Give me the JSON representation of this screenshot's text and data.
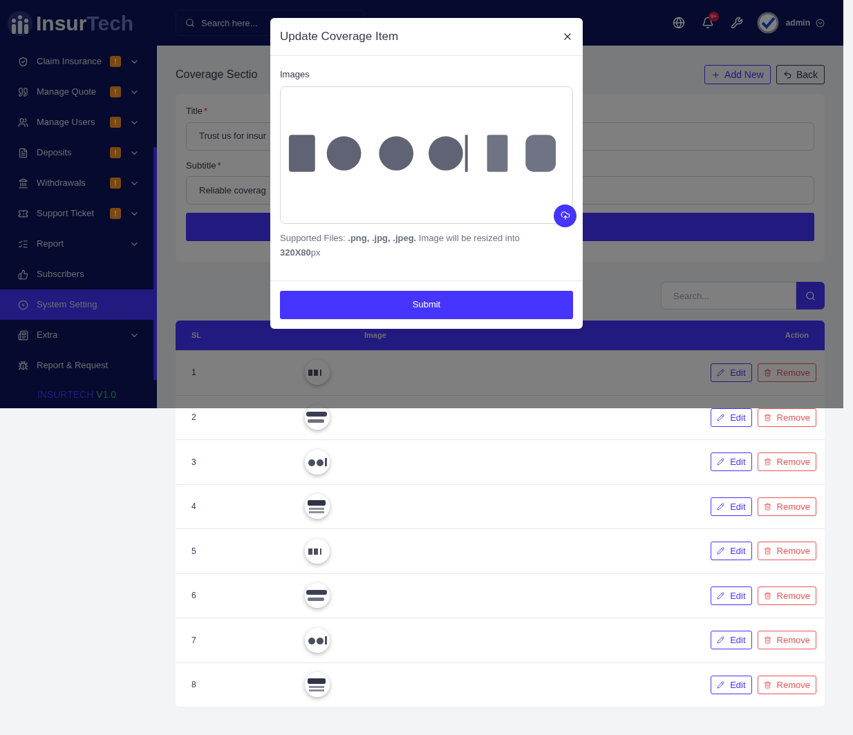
{
  "sidebar": {
    "logo": {
      "part_1": "Insur",
      "part_2": "Tech"
    },
    "items": [
      {
        "label": "Claim Insurance",
        "badge": "!",
        "expandable": true,
        "selected": false
      },
      {
        "label": "Manage Quote",
        "badge": "!",
        "expandable": true,
        "selected": false
      },
      {
        "label": "Manage Users",
        "badge": "!",
        "expandable": true,
        "selected": false
      },
      {
        "label": "Deposits",
        "badge": "!",
        "expandable": true,
        "selected": false
      },
      {
        "label": "Withdrawals",
        "badge": "!",
        "expandable": true,
        "selected": false
      },
      {
        "label": "Support Ticket",
        "badge": "!",
        "expandable": true,
        "selected": false
      },
      {
        "label": "Report",
        "expandable": true,
        "selected": false
      },
      {
        "label": "Subscribers",
        "expandable": false,
        "selected": false
      },
      {
        "label": "System Setting",
        "expandable": false,
        "selected": true
      },
      {
        "label": "Extra",
        "expandable": true,
        "selected": false
      },
      {
        "label": "Report & Request",
        "expandable": false,
        "selected": false
      }
    ],
    "footer": {
      "brand": "INSURTECH",
      "version": "V1.0"
    }
  },
  "header": {
    "search": {
      "placeholder": "Search here..."
    },
    "notification_badge": "9+",
    "user": {
      "name": "admin"
    }
  },
  "page": {
    "title": "Coverage Sectio",
    "buttons": [
      {
        "label": "Add New",
        "kind": "add"
      },
      {
        "label": "Back",
        "kind": "back"
      }
    ]
  },
  "form": {
    "fields": [
      {
        "label": "Title",
        "required_mark": "*",
        "value": "Trust us for insur"
      },
      {
        "label": "Subtitle",
        "required_mark": "*",
        "value": "Reliable coverag"
      }
    ]
  },
  "table": {
    "search": {
      "placeholder": "Search..."
    },
    "columns": [
      "SL",
      "Image",
      "Action"
    ],
    "rows": [
      {
        "sl": "1",
        "actions": [
          {
            "label": "Edit",
            "kind": "edit"
          },
          {
            "label": "Remove",
            "kind": "remove"
          }
        ]
      },
      {
        "sl": "2",
        "actions": [
          {
            "label": "Edit",
            "kind": "edit"
          },
          {
            "label": "Remove",
            "kind": "remove"
          }
        ]
      },
      {
        "sl": "3",
        "actions": [
          {
            "label": "Edit",
            "kind": "edit"
          },
          {
            "label": "Remove",
            "kind": "remove"
          }
        ]
      },
      {
        "sl": "4",
        "actions": [
          {
            "label": "Edit",
            "kind": "edit"
          },
          {
            "label": "Remove",
            "kind": "remove"
          }
        ]
      },
      {
        "sl": "5",
        "actions": [
          {
            "label": "Edit",
            "kind": "edit"
          },
          {
            "label": "Remove",
            "kind": "remove"
          }
        ]
      },
      {
        "sl": "6",
        "actions": [
          {
            "label": "Edit",
            "kind": "edit"
          },
          {
            "label": "Remove",
            "kind": "remove"
          }
        ]
      },
      {
        "sl": "7",
        "actions": [
          {
            "label": "Edit",
            "kind": "edit"
          },
          {
            "label": "Remove",
            "kind": "remove"
          }
        ]
      },
      {
        "sl": "8",
        "actions": [
          {
            "label": "Edit",
            "kind": "edit"
          },
          {
            "label": "Remove",
            "kind": "remove"
          }
        ]
      }
    ]
  },
  "modal": {
    "title": "Update Coverage Item",
    "field_label": "Images",
    "note": "Supported Files: **.png, .jpg, .jpeg.** Image will be resized into **320X80**px",
    "submit": "Submit"
  }
}
